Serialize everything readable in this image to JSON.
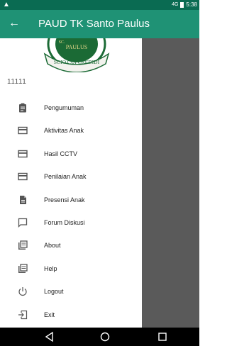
{
  "status_bar": {
    "alert_glyph": "▲",
    "signal": "4G",
    "time": "5:38"
  },
  "app_bar": {
    "title": "PAUD TK Santo Paulus",
    "back_icon": "arrow-back-icon"
  },
  "drawer": {
    "logo": {
      "top_text": "PAULUS",
      "bottom_text": "SCIO CUI CREDIDI",
      "partial_text": "SC."
    },
    "user_id": "11111",
    "items": [
      {
        "label": "Pengumuman",
        "icon": "clipboard-icon"
      },
      {
        "label": "Aktivitas Anak",
        "icon": "card-icon"
      },
      {
        "label": "Hasil CCTV",
        "icon": "card-icon"
      },
      {
        "label": "Penilaian Anak",
        "icon": "card-icon"
      },
      {
        "label": "Presensi Anak",
        "icon": "document-icon"
      },
      {
        "label": "Forum Diskusi",
        "icon": "chat-icon"
      },
      {
        "label": "About",
        "icon": "library-books-icon"
      },
      {
        "label": "Help",
        "icon": "library-books-icon"
      },
      {
        "label": "Logout",
        "icon": "power-icon"
      },
      {
        "label": "Exit",
        "icon": "exit-icon"
      }
    ]
  },
  "colors": {
    "status_bar": "#0a6b52",
    "app_bar": "#1f9275",
    "scrim": "#5a5a5a",
    "logo_green": "#1b6a35"
  },
  "nav_bar": {
    "buttons": [
      "back-triangle-icon",
      "home-circle-icon",
      "recents-square-icon"
    ]
  }
}
